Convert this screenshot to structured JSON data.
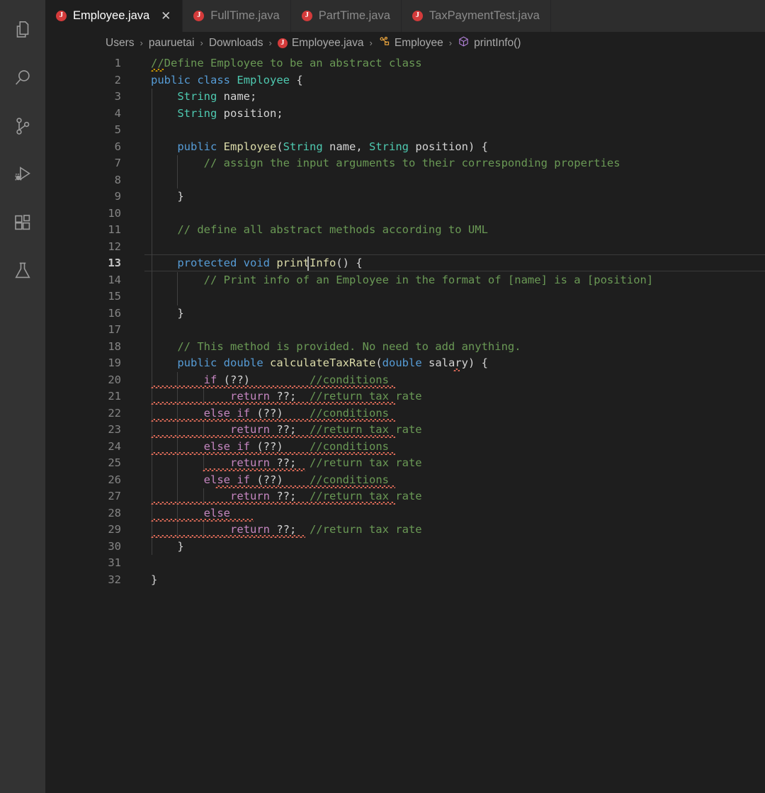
{
  "window": {
    "app": "Visual Studio Code",
    "theme_colors": {
      "editor_bg": "#1E1E1E",
      "tabbar_bg": "#2D2D2D",
      "activitybar_bg": "#333333",
      "linenumber_fg": "#858585",
      "keyword": "#569CD6",
      "control_keyword": "#C586C0",
      "type": "#4EC9B0",
      "function": "#DCDCAA",
      "comment": "#6A9955",
      "plain_text": "#D4D4D4",
      "error_squiggle": "#E26D5A",
      "warning_squiggle": "#CC9900",
      "java_icon": "#D43B3B"
    }
  },
  "activity_bar": {
    "items": [
      {
        "name": "explorer",
        "icon": "files-icon",
        "title": "Explorer"
      },
      {
        "name": "search",
        "icon": "search-icon",
        "title": "Search"
      },
      {
        "name": "source-control",
        "icon": "branch-icon",
        "title": "Source Control"
      },
      {
        "name": "run-debug",
        "icon": "run-debug-icon",
        "title": "Run and Debug"
      },
      {
        "name": "extensions",
        "icon": "extensions-icon",
        "title": "Extensions"
      },
      {
        "name": "testing",
        "icon": "beaker-icon",
        "title": "Testing"
      }
    ]
  },
  "tabs": [
    {
      "label": "Employee.java",
      "active": true,
      "icon": "java-icon",
      "close_label": "✕"
    },
    {
      "label": "FullTime.java",
      "active": false,
      "icon": "java-icon"
    },
    {
      "label": "PartTime.java",
      "active": false,
      "icon": "java-icon"
    },
    {
      "label": "TaxPaymentTest.java",
      "active": false,
      "icon": "java-icon"
    }
  ],
  "breadcrumb": {
    "separator": "›",
    "segments": [
      {
        "label": "Users",
        "icon": null
      },
      {
        "label": "pauruetai",
        "icon": null
      },
      {
        "label": "Downloads",
        "icon": null
      },
      {
        "label": "Employee.java",
        "icon": "java-icon"
      },
      {
        "label": "Employee",
        "icon": "class-icon"
      },
      {
        "label": "printInfo()",
        "icon": "method-icon"
      }
    ]
  },
  "editor": {
    "language": "java",
    "file_name": "Employee.java",
    "active_line": 13,
    "cursor": {
      "line": 13,
      "column": 25
    },
    "total_lines": 32,
    "lines": [
      {
        "n": 1,
        "text": "//Define Employee to be an abstract class"
      },
      {
        "n": 2,
        "text": "public class Employee {"
      },
      {
        "n": 3,
        "text": "    String name;"
      },
      {
        "n": 4,
        "text": "    String position;"
      },
      {
        "n": 5,
        "text": ""
      },
      {
        "n": 6,
        "text": "    public Employee(String name, String position) {"
      },
      {
        "n": 7,
        "text": "        // assign the input arguments to their corresponding properties"
      },
      {
        "n": 8,
        "text": ""
      },
      {
        "n": 9,
        "text": "    }"
      },
      {
        "n": 10,
        "text": ""
      },
      {
        "n": 11,
        "text": "    // define all abstract methods according to UML"
      },
      {
        "n": 12,
        "text": ""
      },
      {
        "n": 13,
        "text": "    protected void printInfo() {"
      },
      {
        "n": 14,
        "text": "        // Print info of an Employee in the format of [name] is a [position]"
      },
      {
        "n": 15,
        "text": ""
      },
      {
        "n": 16,
        "text": "    }"
      },
      {
        "n": 17,
        "text": ""
      },
      {
        "n": 18,
        "text": "    // This method is provided. No need to add anything."
      },
      {
        "n": 19,
        "text": "    public double calculateTaxRate(double salary) {"
      },
      {
        "n": 20,
        "text": "        if (??)         //conditions"
      },
      {
        "n": 21,
        "text": "            return ??;  //return tax rate"
      },
      {
        "n": 22,
        "text": "        else if (??)    //conditions"
      },
      {
        "n": 23,
        "text": "            return ??;  //return tax rate"
      },
      {
        "n": 24,
        "text": "        else if (??)    //conditions"
      },
      {
        "n": 25,
        "text": "            return ??;  //return tax rate"
      },
      {
        "n": 26,
        "text": "        else if (??)    //conditions"
      },
      {
        "n": 27,
        "text": "            return ??;  //return tax rate"
      },
      {
        "n": 28,
        "text": "        else"
      },
      {
        "n": 29,
        "text": "            return ??;  //return tax rate"
      },
      {
        "n": 30,
        "text": "    }"
      },
      {
        "n": 31,
        "text": ""
      },
      {
        "n": 32,
        "text": "}"
      }
    ]
  }
}
